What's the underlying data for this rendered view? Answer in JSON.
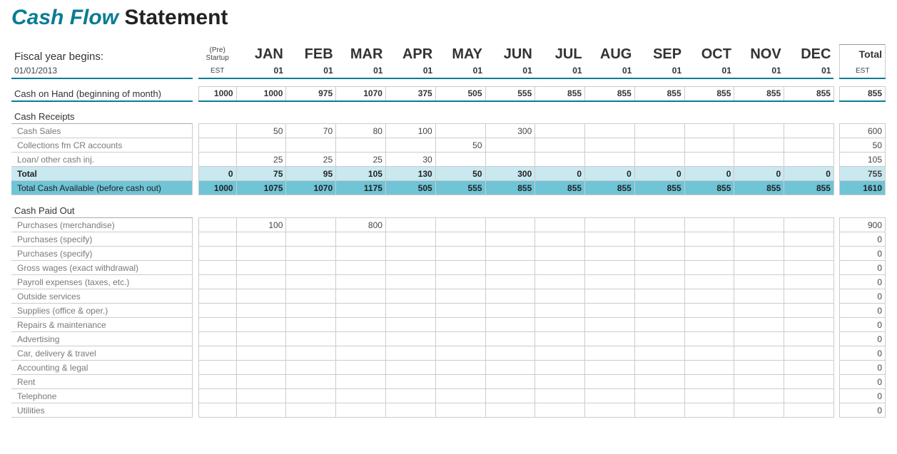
{
  "title": {
    "cash_flow": "Cash Flow",
    "statement": " Statement"
  },
  "fiscal_label": "Fiscal year begins:",
  "fiscal_date": "01/01/2013",
  "pre_startup_lines": [
    "(Pre)",
    "Startup"
  ],
  "est_label": "EST",
  "months": [
    "JAN",
    "FEB",
    "MAR",
    "APR",
    "MAY",
    "JUN",
    "JUL",
    "AUG",
    "SEP",
    "OCT",
    "NOV",
    "DEC"
  ],
  "month_sub": [
    "01",
    "01",
    "01",
    "01",
    "01",
    "01",
    "01",
    "01",
    "01",
    "01",
    "01",
    "01"
  ],
  "total_label": "Total",
  "cash_on_hand": {
    "label": "Cash on Hand (beginning of month)",
    "est": 1000,
    "values": [
      1000,
      975,
      1070,
      375,
      505,
      555,
      855,
      855,
      855,
      855,
      855,
      855
    ],
    "total": 855
  },
  "receipts": {
    "section": "Cash Receipts",
    "rows": [
      {
        "label": "Cash Sales",
        "est": null,
        "values": [
          50,
          70,
          80,
          100,
          null,
          300,
          null,
          null,
          null,
          null,
          null,
          null
        ],
        "total": 600
      },
      {
        "label": "Collections fm CR accounts",
        "est": null,
        "values": [
          null,
          null,
          null,
          null,
          50,
          null,
          null,
          null,
          null,
          null,
          null,
          null
        ],
        "total": 50
      },
      {
        "label": "Loan/ other cash inj.",
        "est": null,
        "values": [
          25,
          25,
          25,
          30,
          null,
          null,
          null,
          null,
          null,
          null,
          null,
          null
        ],
        "total": 105
      }
    ],
    "total_row": {
      "label": "Total",
      "est": 0,
      "values": [
        75,
        95,
        105,
        130,
        50,
        300,
        0,
        0,
        0,
        0,
        0,
        0
      ],
      "total": 755
    },
    "tca_row": {
      "label": "Total Cash Available (before cash out)",
      "est": 1000,
      "values": [
        1075,
        1070,
        1175,
        505,
        555,
        855,
        855,
        855,
        855,
        855,
        855,
        855
      ],
      "total": 1610
    }
  },
  "paid_out": {
    "section": "Cash Paid Out",
    "rows": [
      {
        "label": "Purchases (merchandise)",
        "est": null,
        "values": [
          100,
          null,
          800,
          null,
          null,
          null,
          null,
          null,
          null,
          null,
          null,
          null
        ],
        "total": 900
      },
      {
        "label": "Purchases (specify)",
        "est": null,
        "values": [
          null,
          null,
          null,
          null,
          null,
          null,
          null,
          null,
          null,
          null,
          null,
          null
        ],
        "total": 0
      },
      {
        "label": "Purchases (specify)",
        "est": null,
        "values": [
          null,
          null,
          null,
          null,
          null,
          null,
          null,
          null,
          null,
          null,
          null,
          null
        ],
        "total": 0
      },
      {
        "label": "Gross wages (exact withdrawal)",
        "est": null,
        "values": [
          null,
          null,
          null,
          null,
          null,
          null,
          null,
          null,
          null,
          null,
          null,
          null
        ],
        "total": 0
      },
      {
        "label": "Payroll expenses (taxes, etc.)",
        "est": null,
        "values": [
          null,
          null,
          null,
          null,
          null,
          null,
          null,
          null,
          null,
          null,
          null,
          null
        ],
        "total": 0
      },
      {
        "label": "Outside services",
        "est": null,
        "values": [
          null,
          null,
          null,
          null,
          null,
          null,
          null,
          null,
          null,
          null,
          null,
          null
        ],
        "total": 0
      },
      {
        "label": "Supplies (office & oper.)",
        "est": null,
        "values": [
          null,
          null,
          null,
          null,
          null,
          null,
          null,
          null,
          null,
          null,
          null,
          null
        ],
        "total": 0
      },
      {
        "label": "Repairs & maintenance",
        "est": null,
        "values": [
          null,
          null,
          null,
          null,
          null,
          null,
          null,
          null,
          null,
          null,
          null,
          null
        ],
        "total": 0
      },
      {
        "label": "Advertising",
        "est": null,
        "values": [
          null,
          null,
          null,
          null,
          null,
          null,
          null,
          null,
          null,
          null,
          null,
          null
        ],
        "total": 0
      },
      {
        "label": "Car, delivery & travel",
        "est": null,
        "values": [
          null,
          null,
          null,
          null,
          null,
          null,
          null,
          null,
          null,
          null,
          null,
          null
        ],
        "total": 0
      },
      {
        "label": "Accounting & legal",
        "est": null,
        "values": [
          null,
          null,
          null,
          null,
          null,
          null,
          null,
          null,
          null,
          null,
          null,
          null
        ],
        "total": 0
      },
      {
        "label": "Rent",
        "est": null,
        "values": [
          null,
          null,
          null,
          null,
          null,
          null,
          null,
          null,
          null,
          null,
          null,
          null
        ],
        "total": 0
      },
      {
        "label": "Telephone",
        "est": null,
        "values": [
          null,
          null,
          null,
          null,
          null,
          null,
          null,
          null,
          null,
          null,
          null,
          null
        ],
        "total": 0
      },
      {
        "label": "Utilities",
        "est": null,
        "values": [
          null,
          null,
          null,
          null,
          null,
          null,
          null,
          null,
          null,
          null,
          null,
          null
        ],
        "total": 0
      }
    ]
  }
}
